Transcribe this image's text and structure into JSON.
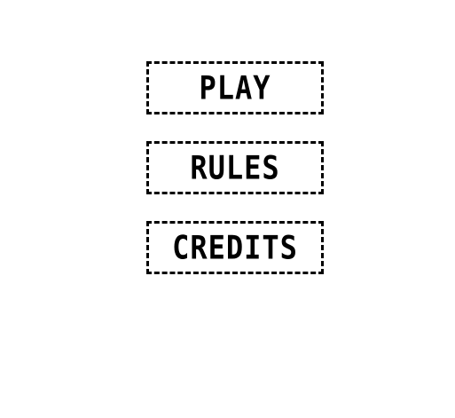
{
  "menu": {
    "play_label": "PLAY",
    "rules_label": "RULES",
    "credits_label": "CREDITS"
  },
  "colors": {
    "background": "#ffffff",
    "border": "#000000",
    "text": "#000000"
  }
}
